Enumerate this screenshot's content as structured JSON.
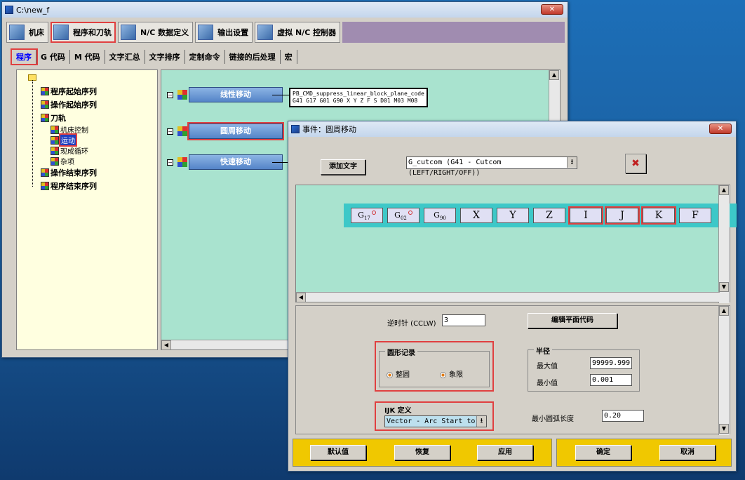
{
  "main_window": {
    "title": "C:\\new_f",
    "close_label": "✕",
    "tabs": [
      {
        "label": "机床",
        "icon": "machine-icon"
      },
      {
        "label": "程序和刀轨",
        "icon": "program-icon"
      },
      {
        "label": "N/C 数据定义",
        "icon": "nc-data-icon"
      },
      {
        "label": "输出设置",
        "icon": "printer-icon"
      },
      {
        "label": "虚拟 N/C 控制器",
        "icon": "controller-icon"
      }
    ],
    "subtabs": [
      "程序",
      "G 代码",
      "M 代码",
      "文字汇总",
      "文字排序",
      "定制命令",
      "链接的后处理",
      "宏"
    ],
    "tree": {
      "items": [
        "程序起始序列",
        "操作起始序列",
        "刀轨",
        "机床控制",
        "运动",
        "现成循环",
        "杂项",
        "操作结束序列",
        "程序结束序列"
      ]
    },
    "blocks": [
      {
        "label": "线性移动"
      },
      {
        "label": "圆周移动"
      },
      {
        "label": "快速移动"
      }
    ],
    "code_line1": "PB_CMD_suppress_linear_block_plane_code",
    "code_line2": "G41 G17 G01 G90 X Y Z F S D01 M03 M08"
  },
  "dialog": {
    "title": "事件：圆周移动",
    "close_label": "✕",
    "add_text_label": "添加文字",
    "cutcom_value": "G_cutcom (G41 - Cutcom (LEFT/RIGHT/OFF))",
    "gcodes": [
      {
        "label": "G",
        "sub": "17",
        "dot": true
      },
      {
        "label": "G",
        "sub": "02",
        "dot": true
      },
      {
        "label": "G",
        "sub": "90",
        "dot": false
      },
      {
        "label": "X"
      },
      {
        "label": "Y"
      },
      {
        "label": "Z"
      },
      {
        "label": "I"
      },
      {
        "label": "J"
      },
      {
        "label": "K"
      },
      {
        "label": "F"
      }
    ],
    "ccw_label": "逆时针 (CCLW)",
    "ccw_value": "3",
    "edit_plane_label": "编辑平面代码",
    "circle_record": {
      "title": "圆形记录",
      "opt1": "整圆",
      "opt2": "象限"
    },
    "radius": {
      "title": "半径",
      "max_label": "最大值",
      "max_value": "99999.999",
      "min_label": "最小值",
      "min_value": "0.001"
    },
    "ijk": {
      "title": "IJK 定义",
      "value": "Vector - Arc Start to"
    },
    "min_arc_label": "最小圆弧长度",
    "min_arc_value": "0.20",
    "buttons": {
      "default": "默认值",
      "restore": "恢复",
      "apply": "应用",
      "ok": "确定",
      "cancel": "取消"
    }
  }
}
